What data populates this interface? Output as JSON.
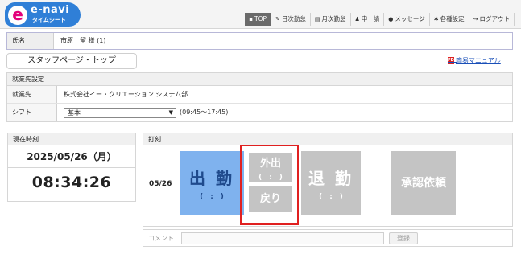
{
  "app": {
    "logo_name": "e-navi",
    "logo_sub": "タイムシート",
    "logo_letter": "e"
  },
  "nav": [
    {
      "label": "TOP",
      "icon": "home-icon",
      "glyph": "▪",
      "active": true
    },
    {
      "label": "日次勤怠",
      "icon": "pencil-icon",
      "glyph": "✎"
    },
    {
      "label": "月次勤怠",
      "icon": "calendar-icon",
      "glyph": "▤"
    },
    {
      "label": "申　請",
      "icon": "user-icon",
      "glyph": "♟"
    },
    {
      "label": "メッセージ",
      "icon": "message-icon",
      "glyph": "●"
    },
    {
      "label": "各種設定",
      "icon": "gear-icon",
      "glyph": "✱"
    },
    {
      "label": "ログアウト",
      "icon": "logout-icon",
      "glyph": "↪"
    }
  ],
  "user": {
    "label": "氏名",
    "value": "市原　留 様 (1)"
  },
  "staff_page_button": "スタッフページ・トップ",
  "manual_link": "簡易マニュアル",
  "employment": {
    "title": "就業先設定",
    "workplace_label": "就業先",
    "workplace_value": "株式会社イー・クリエーション システム部",
    "shift_label": "シフト",
    "shift_selected": "基本",
    "shift_time": "(09:45～17:45)"
  },
  "clock": {
    "title": "現在時刻",
    "date": "2025/05/26（月）",
    "time": "08:34:26"
  },
  "punch": {
    "title": "打刻",
    "date": "05/26",
    "clock_in": {
      "label": "出 勤",
      "time": "(　:　)"
    },
    "go_out": {
      "label": "外出",
      "time": "(　:　)"
    },
    "return": {
      "label": "戻り"
    },
    "clock_out": {
      "label": "退 勤",
      "time": "(　:　)"
    },
    "approval": {
      "label": "承認依頼"
    }
  },
  "comment": {
    "label": "コメント",
    "value": "",
    "button": "登録"
  },
  "colors": {
    "clock_in_bg": "#7fb2ee",
    "disabled_bg": "#c4c4c4",
    "highlight": "#e02020",
    "logo_blue": "#2f7fd7",
    "logo_pink": "#e3007a"
  }
}
